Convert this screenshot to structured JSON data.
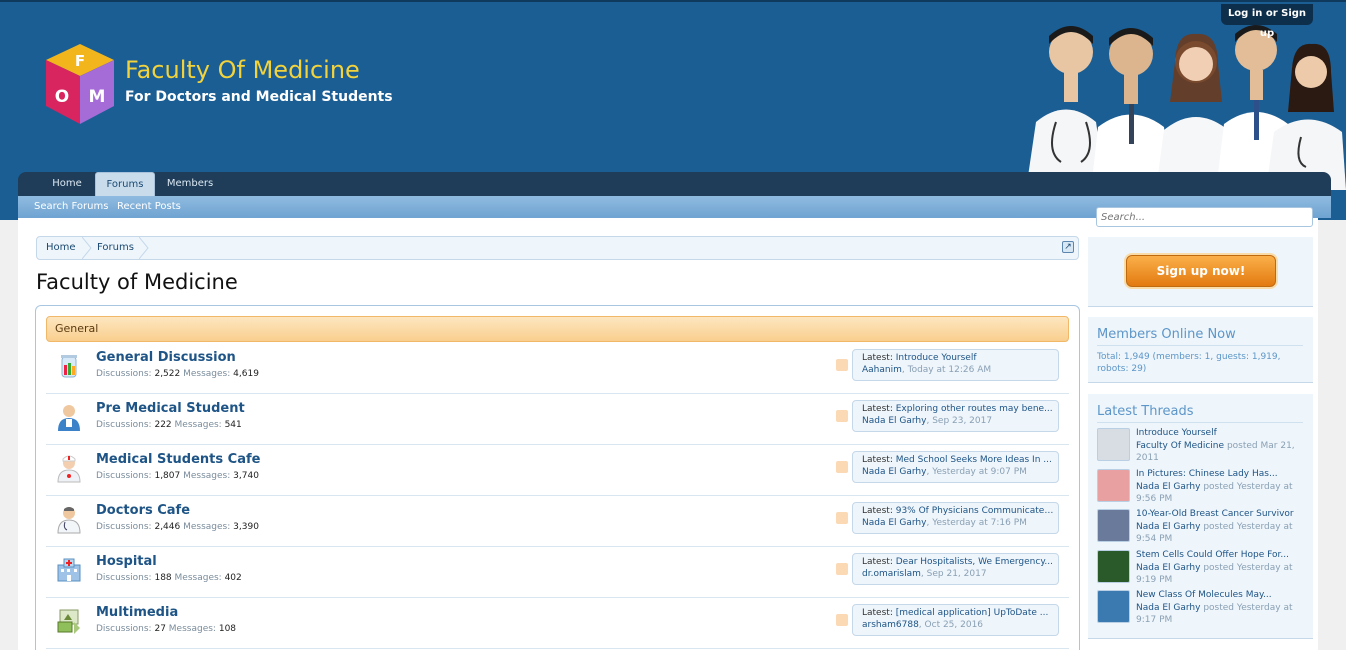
{
  "header": {
    "logo_title": "Faculty Of Medicine",
    "logo_subtitle": "For Doctors and Medical Students",
    "logo_letters": [
      "F",
      "O",
      "M"
    ],
    "login_label": "Log in or Sign up"
  },
  "nav": {
    "tabs": [
      "Home",
      "Forums",
      "Members"
    ],
    "active_tab": "Forums",
    "sub_items": [
      "Search Forums",
      "Recent Posts"
    ]
  },
  "breadcrumb": [
    "Home",
    "Forums"
  ],
  "page_title": "Faculty of Medicine",
  "category": "General",
  "labels": {
    "discussions": "Discussions:",
    "messages": "Messages:",
    "latest": "Latest:",
    "posted": "posted"
  },
  "forums": [
    {
      "title": "General Discussion",
      "discussions": "2,522",
      "messages": "4,619",
      "latest_title": "Introduce Yourself",
      "latest_user": "Aahanim",
      "latest_date": "Today at 12:26 AM",
      "icon": "beaker-icon"
    },
    {
      "title": "Pre Medical Student",
      "discussions": "222",
      "messages": "541",
      "latest_title": "Exploring other routes may bene...",
      "latest_user": "Nada El Garhy",
      "latest_date": "Sep 23, 2017",
      "icon": "student-icon"
    },
    {
      "title": "Medical Students Cafe",
      "discussions": "1,807",
      "messages": "3,740",
      "latest_title": "Med School Seeks More Ideas In ...",
      "latest_user": "Nada El Garhy",
      "latest_date": "Yesterday at 9:07 PM",
      "icon": "nurse-icon"
    },
    {
      "title": "Doctors Cafe",
      "discussions": "2,446",
      "messages": "3,390",
      "latest_title": "93% Of Physicians Communicate ...",
      "latest_user": "Nada El Garhy",
      "latest_date": "Yesterday at 7:16 PM",
      "icon": "doctor-icon"
    },
    {
      "title": "Hospital",
      "discussions": "188",
      "messages": "402",
      "latest_title": "Dear Hospitalists, We Emergency...",
      "latest_user": "dr.omarislam",
      "latest_date": "Sep 21, 2017",
      "icon": "hospital-icon"
    },
    {
      "title": "Multimedia",
      "discussions": "27",
      "messages": "108",
      "latest_title": "[medical application] UpToDate ...",
      "latest_user": "arsham6788",
      "latest_date": "Oct 25, 2016",
      "icon": "multimedia-icon"
    }
  ],
  "sidebar": {
    "search_placeholder": "Search...",
    "signup_label": "Sign up now!",
    "members_online_heading": "Members Online Now",
    "members_online_text": "Total: 1,949 (members: 1, guests: 1,919, robots: 29)",
    "latest_threads_heading": "Latest Threads",
    "threads": [
      {
        "title": "Introduce Yourself",
        "user": "Faculty Of Medicine",
        "date": "Mar 21, 2011"
      },
      {
        "title": "In Pictures: Chinese Lady Has...",
        "user": "Nada El Garhy",
        "date": "Yesterday at 9:56 PM"
      },
      {
        "title": "10-Year-Old Breast Cancer Survivor",
        "user": "Nada El Garhy",
        "date": "Yesterday at 9:54 PM"
      },
      {
        "title": "Stem Cells Could Offer Hope For...",
        "user": "Nada El Garhy",
        "date": "Yesterday at 9:19 PM"
      },
      {
        "title": "New Class Of Molecules May...",
        "user": "Nada El Garhy",
        "date": "Yesterday at 9:17 PM"
      }
    ]
  },
  "colors": {
    "header_bg": "#1b5e94",
    "logo_title": "#f2d33c",
    "link": "#1e5486",
    "category_bg": "#f9cf8e",
    "signup_button": "#e27a10"
  }
}
